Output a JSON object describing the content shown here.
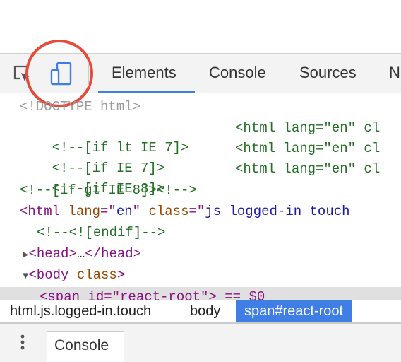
{
  "toolbar": {
    "icons": {
      "inspect": "inspect-element-icon",
      "device": "device-toolbar-icon"
    },
    "tabs": [
      {
        "label": "Elements",
        "active": true
      },
      {
        "label": "Console",
        "active": false
      },
      {
        "label": "Sources",
        "active": false
      },
      {
        "label": "N",
        "active": false
      }
    ]
  },
  "code": {
    "doctype": "<!DOCTYPE html>",
    "lt7_cond": "<!--[if lt IE 7]>",
    "lt7_html": "<html lang=\"en\" cl",
    "ie7_cond": "<!--[if IE 7]>",
    "ie7_html": "<html lang=\"en\" cl",
    "ie8_cond": "<!--[if IE 8]>",
    "ie8_html": "<html lang=\"en\" cl",
    "gt8_cond": "<!--[if gt IE 8]><!-->",
    "html_open": "<html",
    "html_attr1": " lang",
    "html_eq1": "=\"",
    "html_val1": "en",
    "html_q1": "\"",
    "html_attr2": " class",
    "html_eq2": "=\"",
    "html_val2": "js logged-in touch",
    "endif": "<!--<![endif]-->",
    "head_open": "<head>",
    "head_ellipsis": "…",
    "head_close": "</head>",
    "body_open": "<body",
    "body_attr": " class",
    "body_close": ">",
    "span_line": "<span id=\"react-root\"> == $0"
  },
  "breadcrumb": {
    "items": [
      "html.js.logged-in.touch",
      "body",
      "span#react-root"
    ],
    "selected_index": 2
  },
  "drawer": {
    "tab_label": "Console"
  },
  "colors": {
    "accent": "#3f7ee5",
    "highlight_circle": "#e64a3a"
  }
}
